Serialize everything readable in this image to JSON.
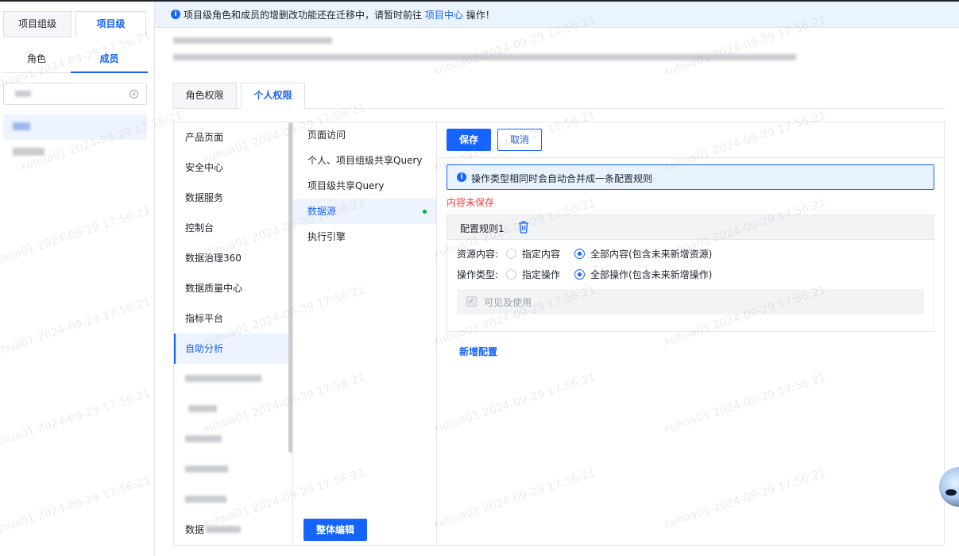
{
  "level_tabs": {
    "project_group": "项目组级",
    "project": "项目级"
  },
  "role_member_tabs": {
    "role": "角色",
    "member": "成员"
  },
  "banner": {
    "text_before": "项目级角色和成员的增删改功能还在迁移中，请暂时前往",
    "link": "项目中心",
    "text_after": "操作！",
    "icon": "info-icon"
  },
  "perm_tabs": {
    "role": "角色权限",
    "personal": "个人权限"
  },
  "products": [
    {
      "label": "产品页面"
    },
    {
      "label": "安全中心"
    },
    {
      "label": "数据服务"
    },
    {
      "label": "控制台"
    },
    {
      "label": "数据治理360"
    },
    {
      "label": "数据质量中心"
    },
    {
      "label": "指标平台"
    },
    {
      "label": "自助分析"
    }
  ],
  "products_partial_label": "数据",
  "sub_items": [
    {
      "label": "页面访问"
    },
    {
      "label": "个人、项目组级共享Query"
    },
    {
      "label": "项目级共享Query"
    },
    {
      "label": "数据源"
    },
    {
      "label": "执行引擎"
    }
  ],
  "buttons": {
    "save": "保存",
    "cancel": "取消",
    "bulk_edit": "整体编辑",
    "add_config": "新增配置"
  },
  "notice": "操作类型相同时会自动合并成一条配置规则",
  "unsaved": "内容未保存",
  "rule": {
    "title": "配置规则1",
    "resource_label": "资源内容:",
    "resource_opt1": "指定内容",
    "resource_opt2": "全部内容(包含未来新增资源)",
    "op_label": "操作类型:",
    "op_opt1": "指定操作",
    "op_opt2": "全部操作(包含未来新增操作)",
    "visible_use": "可见及使用"
  },
  "watermark": "xuhua01 2024-09-29 17:56:21",
  "colors": {
    "primary": "#1664ff",
    "danger": "#f53f3f",
    "success": "#00b42a"
  }
}
